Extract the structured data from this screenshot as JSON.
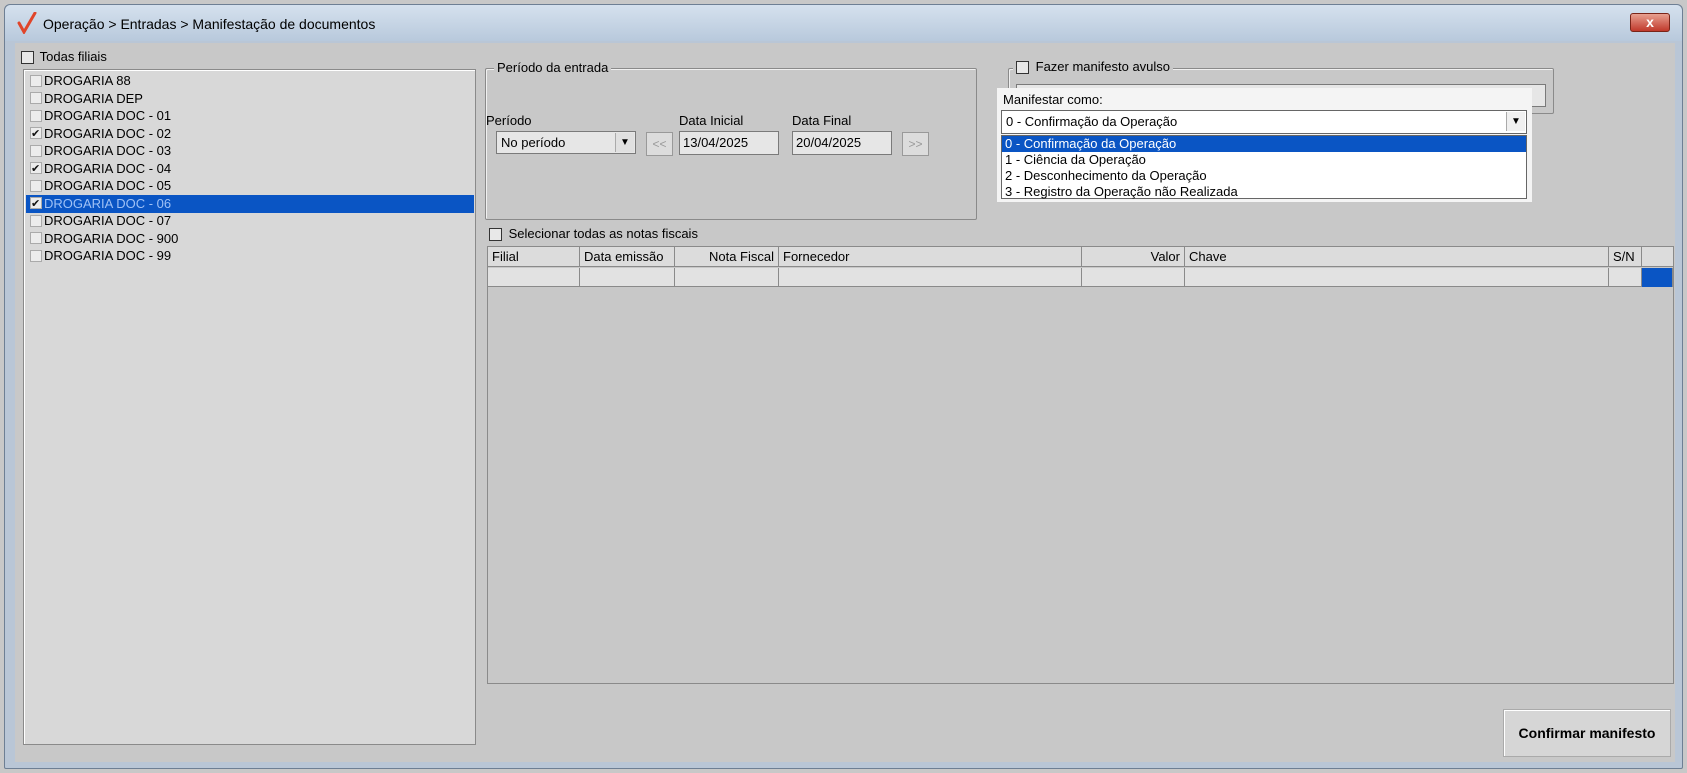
{
  "window": {
    "title": "Operação > Entradas > Manifestação de documentos",
    "close_label": "x"
  },
  "branches": {
    "all_label": "Todas filiais",
    "items": [
      {
        "label": "DROGARIA 88",
        "checked": false
      },
      {
        "label": "DROGARIA DEP",
        "checked": false
      },
      {
        "label": "DROGARIA DOC - 01",
        "checked": false
      },
      {
        "label": "DROGARIA DOC - 02",
        "checked": true
      },
      {
        "label": "DROGARIA DOC - 03",
        "checked": false
      },
      {
        "label": "DROGARIA DOC - 04",
        "checked": true
      },
      {
        "label": "DROGARIA DOC - 05",
        "checked": false
      },
      {
        "label": "DROGARIA DOC - 06",
        "checked": true,
        "selected": true
      },
      {
        "label": "DROGARIA DOC - 07",
        "checked": false
      },
      {
        "label": "DROGARIA DOC - 900",
        "checked": false
      },
      {
        "label": "DROGARIA DOC - 99",
        "checked": false
      }
    ]
  },
  "period": {
    "group_label": "Período da entrada",
    "period_label": "Período",
    "period_value": "No período",
    "start_label": "Data Inicial",
    "start_value": "13/04/2025",
    "end_label": "Data Final",
    "end_value": "20/04/2025",
    "prev_label": "<<",
    "next_label": ">>"
  },
  "avulso": {
    "label": "Fazer manifesto avulso",
    "value": ""
  },
  "manifest": {
    "label": "Manifestar como:",
    "selected": "0 - Confirmação da Operação",
    "options": [
      "0 - Confirmação da Operação",
      "1 - Ciência da Operação",
      "2 - Desconhecimento da Operação",
      "3 - Registro da Operação não Realizada"
    ]
  },
  "notes": {
    "select_all_label": "Selecionar todas as notas fiscais",
    "columns": [
      "Filial",
      "Data emissão",
      "Nota Fiscal",
      "Fornecedor",
      "Valor",
      "Chave",
      "S/N"
    ]
  },
  "actions": {
    "confirm_label": "Confirmar manifesto"
  },
  "colors": {
    "selection": "#0a55c4",
    "background": "#c8c8c8"
  }
}
